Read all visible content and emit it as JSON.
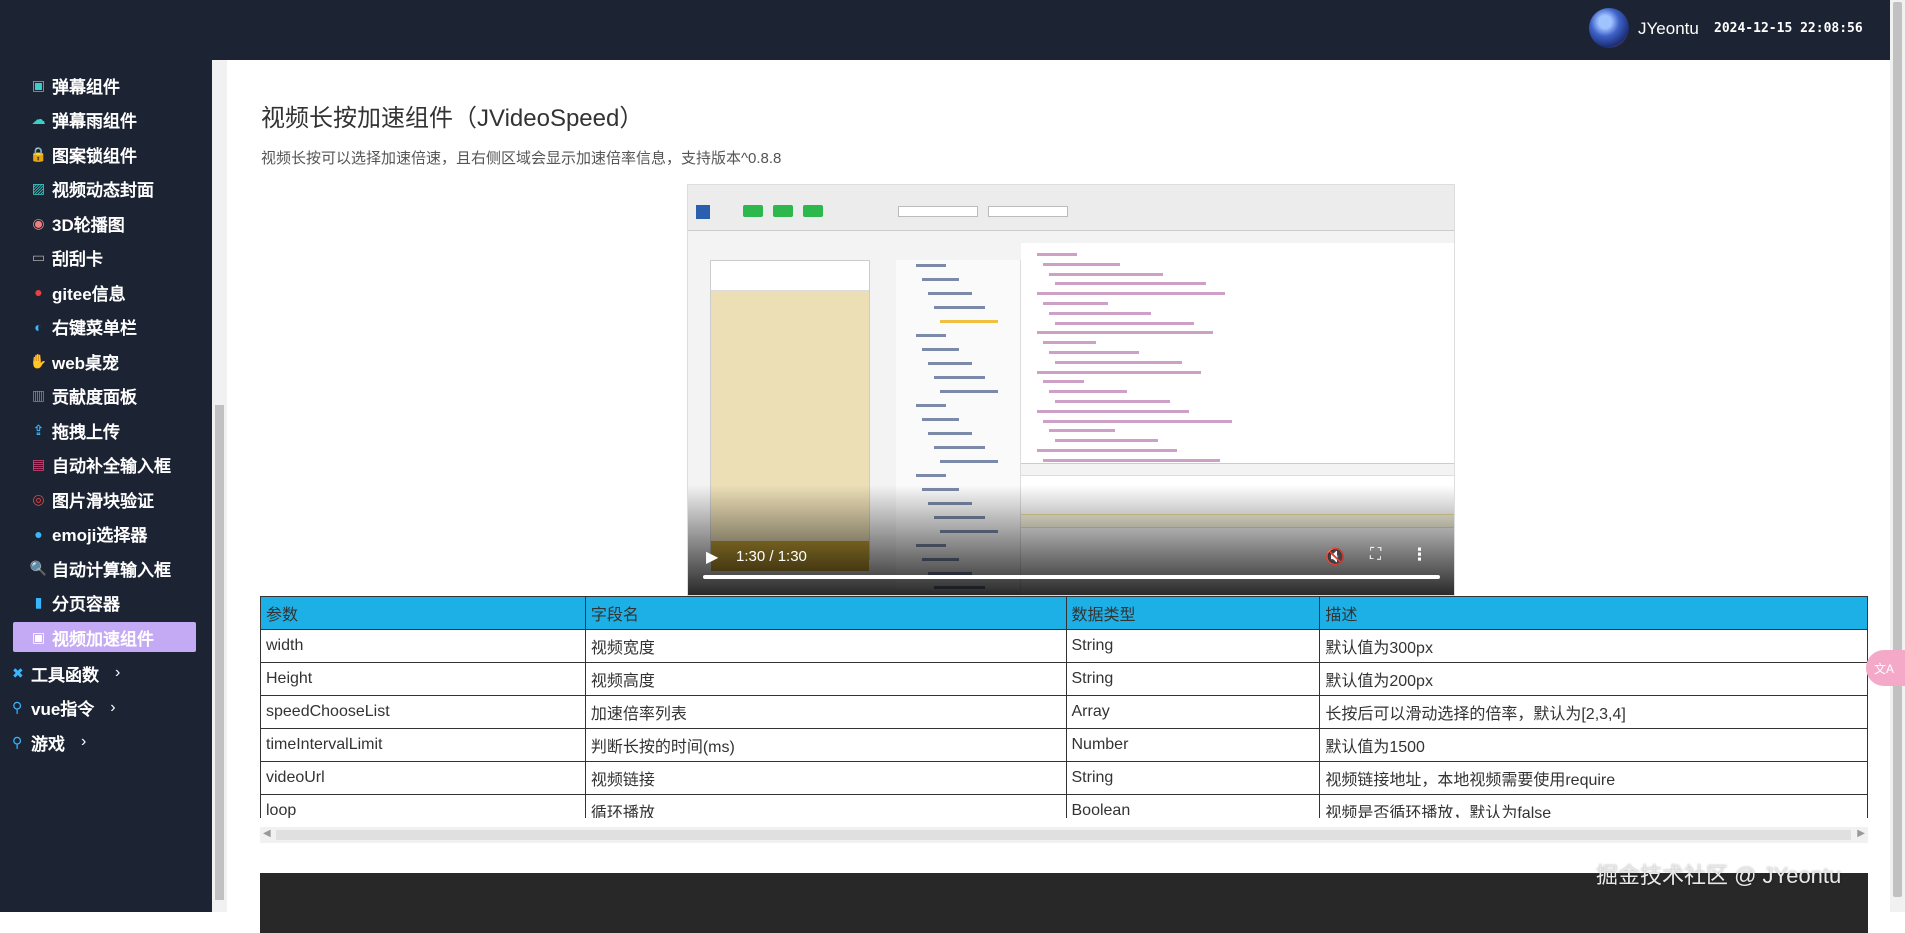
{
  "header": {
    "username": "JYeontu",
    "datetime": "2024-12-15 22:08:56"
  },
  "sidebar": {
    "items": [
      {
        "label": "弹幕组件",
        "icon": "chat-icon",
        "color": "#3ad0c8"
      },
      {
        "label": "弹幕雨组件",
        "icon": "rain-icon",
        "color": "#3ad0c8"
      },
      {
        "label": "图案锁组件",
        "icon": "lock-icon",
        "color": "#3b6cf5"
      },
      {
        "label": "视频动态封面",
        "icon": "image-icon",
        "color": "#3ad0c8"
      },
      {
        "label": "3D轮播图",
        "icon": "carousel-icon",
        "color": "#f08080"
      },
      {
        "label": "刮刮卡",
        "icon": "card-icon",
        "color": "#aaaaaa"
      },
      {
        "label": "gitee信息",
        "icon": "gitee-icon",
        "color": "#e84343"
      },
      {
        "label": "右键菜单栏",
        "icon": "mouse-icon",
        "color": "#38b6ff"
      },
      {
        "label": "web桌宠",
        "icon": "pet-icon",
        "color": "#f2a33c"
      },
      {
        "label": "贡献度面板",
        "icon": "chart-icon",
        "color": "#2fb86b"
      },
      {
        "label": "拖拽上传",
        "icon": "upload-icon",
        "color": "#38b6ff"
      },
      {
        "label": "自动补全输入框",
        "icon": "input-icon",
        "color": "#e0457b"
      },
      {
        "label": "图片滑块验证",
        "icon": "slider-icon",
        "color": "#e84343"
      },
      {
        "label": "emoji选择器",
        "icon": "emoji-icon",
        "color": "#38b6ff"
      },
      {
        "label": "自动计算输入框",
        "icon": "search-icon",
        "color": "#38b6ff"
      },
      {
        "label": "分页容器",
        "icon": "page-icon",
        "color": "#38b6ff"
      },
      {
        "label": "视频加速组件",
        "icon": "video-icon",
        "color": "#ffffff"
      }
    ],
    "groups": [
      {
        "label": "工具函数",
        "icon": "tools-icon"
      },
      {
        "label": "vue指令",
        "icon": "bike-icon"
      },
      {
        "label": "游戏",
        "icon": "game-icon"
      }
    ]
  },
  "main": {
    "title": "视频长按加速组件（JVideoSpeed）",
    "description": "视频长按可以选择加速倍速，且右侧区域会显示加速倍率信息，支持版本^0.8.8",
    "video": {
      "time": "1:30 / 1:30",
      "progress": 1.0
    },
    "table": {
      "headers": [
        "参数",
        "字段名",
        "数据类型",
        "描述"
      ],
      "rows": [
        [
          "width",
          "视频宽度",
          "String",
          "默认值为300px"
        ],
        [
          "Height",
          "视频高度",
          "String",
          "默认值为200px"
        ],
        [
          "speedChooseList",
          "加速倍率列表",
          "Array",
          "长按后可以滑动选择的倍率，默认为[2,3,4]"
        ],
        [
          "timeIntervalLimit",
          "判断长按的时间(ms)",
          "Number",
          "默认值为1500"
        ],
        [
          "videoUrl",
          "视频链接",
          "String",
          "视频链接地址，本地视频需要使用require"
        ],
        [
          "loop",
          "循环播放",
          "Boolean",
          "视频是否循环播放，默认为false"
        ]
      ]
    }
  },
  "watermark": "掘金技术社区 @ JYeontu",
  "colors": {
    "sidebar_bg": "#1c2333",
    "active_item": "#c4a9f5",
    "table_header": "#1db0e6"
  }
}
